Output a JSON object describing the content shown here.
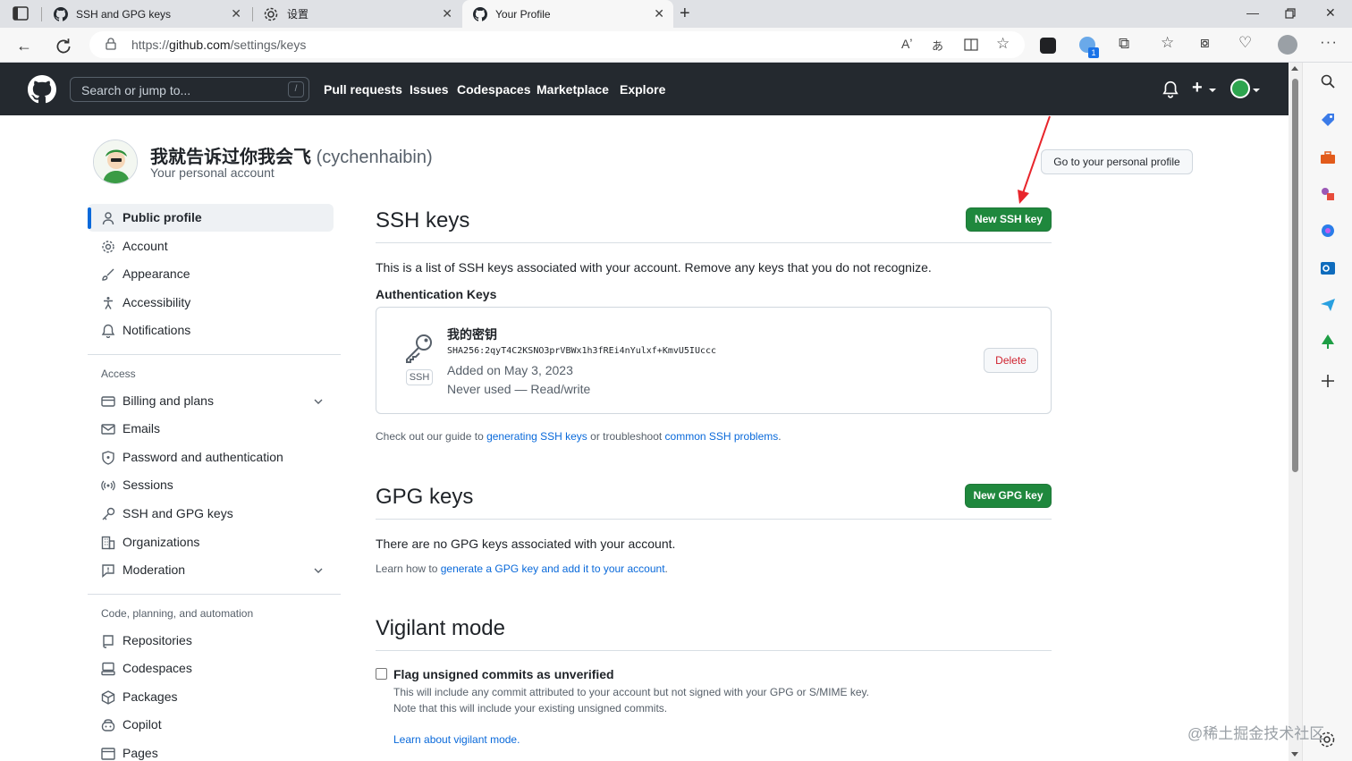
{
  "browser": {
    "tabs": [
      {
        "title": "SSH and GPG keys",
        "icon": "github-icon"
      },
      {
        "title": "设置",
        "icon": "gear-icon"
      },
      {
        "title": "Your Profile",
        "icon": "github-icon"
      }
    ],
    "url_prefix": "https://",
    "url_host": "github.com",
    "url_path": "/settings/keys",
    "extension_badge": "1"
  },
  "gh": {
    "search_placeholder": "Search or jump to...",
    "slash_hint": "/",
    "nav": [
      "Pull requests",
      "Issues",
      "Codespaces",
      "Marketplace",
      "Explore"
    ]
  },
  "profile": {
    "name": "我就告诉过你我会飞",
    "login": "(cychenhaibin)",
    "subtitle": "Your personal account",
    "go_profile_label": "Go to your personal profile"
  },
  "sidebar": {
    "top_items": [
      {
        "label": "Public profile",
        "icon": "person-icon"
      },
      {
        "label": "Account",
        "icon": "gear-icon"
      },
      {
        "label": "Appearance",
        "icon": "paintbrush-icon"
      },
      {
        "label": "Accessibility",
        "icon": "accessibility-icon"
      },
      {
        "label": "Notifications",
        "icon": "bell-icon"
      }
    ],
    "access_heading": "Access",
    "access_items": [
      {
        "label": "Billing and plans",
        "icon": "credit-card-icon"
      },
      {
        "label": "Emails",
        "icon": "mail-icon"
      },
      {
        "label": "Password and authentication",
        "icon": "shield-lock-icon"
      },
      {
        "label": "Sessions",
        "icon": "broadcast-icon"
      },
      {
        "label": "SSH and GPG keys",
        "icon": "key-icon"
      },
      {
        "label": "Organizations",
        "icon": "organization-icon"
      },
      {
        "label": "Moderation",
        "icon": "report-icon"
      }
    ],
    "code_heading": "Code, planning, and automation",
    "code_items": [
      {
        "label": "Repositories",
        "icon": "repo-icon"
      },
      {
        "label": "Codespaces",
        "icon": "codespaces-icon"
      },
      {
        "label": "Packages",
        "icon": "package-icon"
      },
      {
        "label": "Copilot",
        "icon": "copilot-icon"
      },
      {
        "label": "Pages",
        "icon": "browser-icon"
      }
    ]
  },
  "ssh": {
    "title": "SSH keys",
    "new_button": "New SSH key",
    "description": "This is a list of SSH keys associated with your account. Remove any keys that you do not recognize.",
    "auth_heading": "Authentication Keys",
    "key": {
      "title": "我的密钥",
      "fingerprint": "SHA256:2qyT4C2KSNO3prVBWx1h3fREi4nYulxf+KmvU5IUccc",
      "added": "Added on May 3, 2023",
      "used": "Never used — Read/write",
      "badge": "SSH",
      "delete_label": "Delete"
    },
    "guide_prefix": "Check out our guide to ",
    "guide_link1": "generating SSH keys",
    "guide_mid": " or troubleshoot ",
    "guide_link2": "common SSH problems",
    "guide_suffix": "."
  },
  "gpg": {
    "title": "GPG keys",
    "new_button": "New GPG key",
    "empty_text": "There are no GPG keys associated with your account.",
    "learn_prefix": "Learn how to ",
    "learn_link": "generate a GPG key and add it to your account",
    "learn_suffix": "."
  },
  "vigilant": {
    "title": "Vigilant mode",
    "checkbox_label": "Flag unsigned commits as unverified",
    "checked": false,
    "desc1": "This will include any commit attributed to your account but not signed with your GPG or S/MIME key.",
    "desc2": "Note that this will include your existing unsigned commits.",
    "learn_link": "Learn about vigilant mode."
  },
  "watermark": "@稀土掘金技术社区",
  "colors": {
    "header_bg": "#24292f",
    "primary_green": "#1f883d",
    "link_blue": "#0969da",
    "danger_red": "#cf222e",
    "annotation_red": "#e8262c"
  }
}
